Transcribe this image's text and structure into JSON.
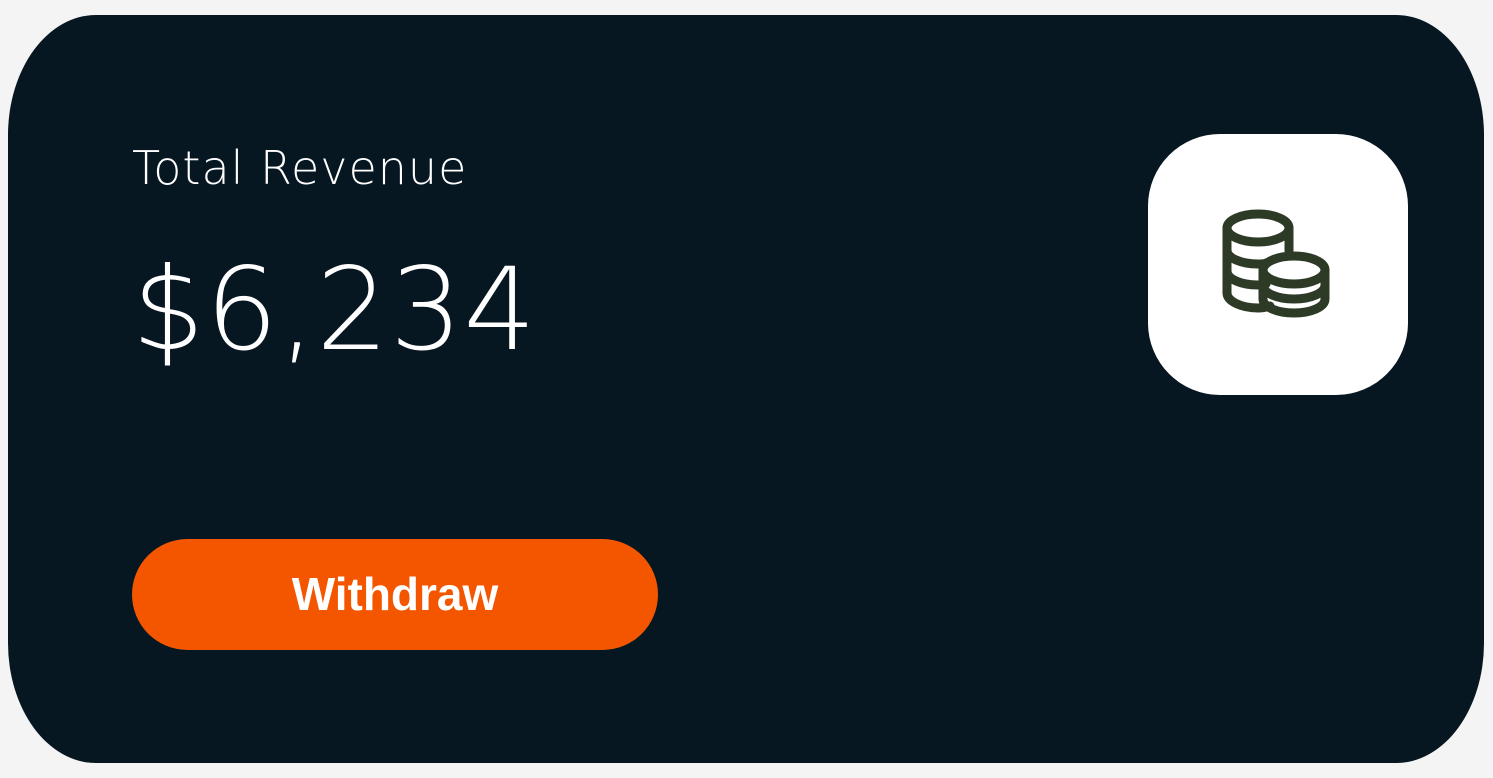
{
  "card": {
    "title": "Total Revenue",
    "amount": "$6,234",
    "withdraw_label": "Withdraw",
    "icon": "coins-icon"
  },
  "colors": {
    "card_background": "#071722",
    "accent": "#f45600",
    "text": "#ffffff",
    "icon_stroke": "#2d3a26"
  }
}
